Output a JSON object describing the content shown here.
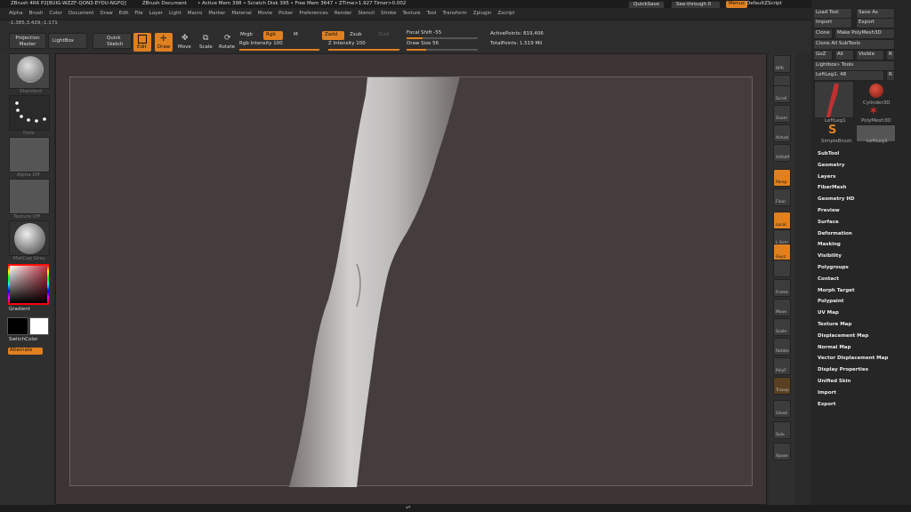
{
  "title_bar": {
    "app": "ZBrush 4R6 P2[8UIG-WZZF-QON3-EYDU-NGFQ]",
    "document": "ZBrush Document",
    "stats": "• Active Mem 398 • Scratch Disk 395 • Free Mem 3647 • ZTime>1.927 Timer>0.002",
    "quicksave": "QuickSave",
    "see_through": "See-through 0",
    "menus_label": "Menus",
    "script_label": "DefaultZScript"
  },
  "menu": {
    "items": [
      "Alpha",
      "Brush",
      "Color",
      "Document",
      "Draw",
      "Edit",
      "File",
      "Layer",
      "Light",
      "Macro",
      "Marker",
      "Material",
      "Movie",
      "Picker",
      "Preferences",
      "Render",
      "Stencil",
      "Stroke",
      "Texture",
      "Tool",
      "Transform",
      "Zplugin",
      "Zscript"
    ]
  },
  "coords": "-1.385,3.429,-1.171",
  "toolbar": {
    "projection_master": "Projection Master",
    "lightbox": "LightBox",
    "quick_sketch": "Quick Sketch",
    "edit": "Edit",
    "draw": "Draw",
    "move": "Move",
    "scale": "Scale",
    "rotate": "Rotate",
    "mrgb": "Mrgb",
    "rgb": "Rgb",
    "m": "M",
    "zadd": "Zadd",
    "zsub": "Zsub",
    "zcut": "Zcut",
    "rgb_intensity": "Rgb Intensity 100",
    "z_intensity": "Z Intensity 100",
    "focal_shift": "Focal Shift -55",
    "draw_size": "Draw Size 56",
    "active_points": "ActivePoints: 819,406",
    "total_points": "TotalPoints: 1.519 Mil"
  },
  "left_shelf": {
    "brush": "Standard",
    "stroke": "Dots",
    "alpha": "Alpha Off",
    "texture": "Texture Off",
    "material": "MatCap Gray",
    "gradient": "Gradient",
    "switch_color": "SwitchColor",
    "alternate": "Alternate"
  },
  "right_shelf": {
    "items": [
      "BPR",
      "SPix 3",
      "Scroll",
      "Zoom",
      "Actual",
      "AAHalf",
      "Persp",
      "Floor",
      "Local",
      "L.Sym",
      "Gxyz",
      "",
      "Frame",
      "Move",
      "Scale",
      "Rotate",
      "PolyF",
      "Transp",
      "Ghost",
      "Solo",
      "Xpose"
    ]
  },
  "tool_panel": {
    "load_tool": "Load Tool",
    "save_as": "Save As",
    "import": "Import",
    "export": "Export",
    "clone": "Clone",
    "make_polymesh": "Make PolyMesh3D",
    "clone_all": "Clone All SubTools",
    "goz": "GoZ",
    "all": "All",
    "visible": "Visible",
    "r": "R",
    "lightbox_tools": "Lightbox» Tools",
    "current_tool": "LeftLeg1. 48",
    "thumbs": [
      {
        "label": "LeftLeg1"
      },
      {
        "label": "Cylinder3D"
      },
      {
        "label": "PolyMesh3D"
      },
      {
        "label": "SimpleBrush"
      },
      {
        "label": "LeftLeg1"
      }
    ],
    "sections": [
      "SubTool",
      "Geometry",
      "Layers",
      "FiberMesh",
      "Geometry HD",
      "Preview",
      "Surface",
      "Deformation",
      "Masking",
      "Visibility",
      "Polygroups",
      "Contact",
      "Morph Target",
      "Polypaint",
      "UV Map",
      "Texture Map",
      "Displacement Map",
      "Normal Map",
      "Vector Displacement Map",
      "Display Properties",
      "Unified Skin",
      "Import",
      "Export"
    ]
  },
  "colors": {
    "accent": "#e08020",
    "canvas": "#453d3d",
    "ui": "#2d2d2d"
  }
}
